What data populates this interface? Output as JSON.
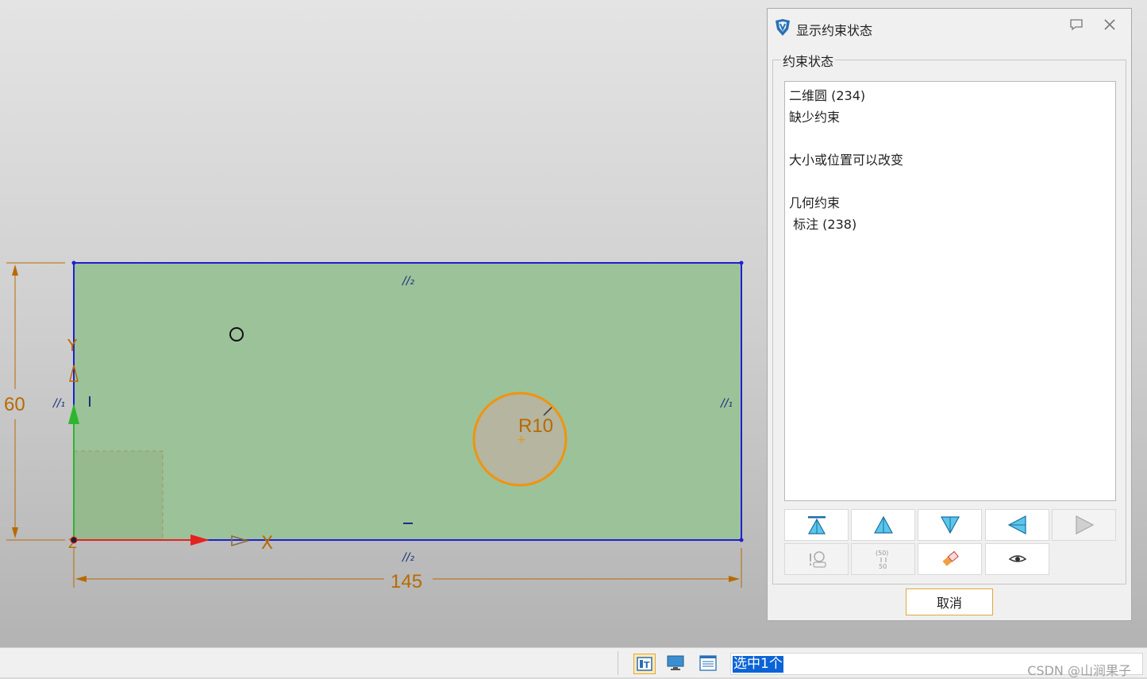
{
  "sketch": {
    "dim_height": "60",
    "dim_width": "145",
    "radius_label": "R10",
    "axis_x": "X",
    "axis_y": "Y",
    "axis_z": "Z",
    "constraint_parallel_top": "//₂",
    "constraint_parallel_bottom": "//₂",
    "constraint_parallel_left": "//₁",
    "constraint_parallel_right": "//₁",
    "colors": {
      "region_fill": "#9cc29a",
      "edge": "#1f1fd4",
      "dimension": "#b86a00",
      "circle": "#f0940e",
      "x_axis": "#e52222",
      "y_axis": "#2db52d"
    }
  },
  "dialog": {
    "title": "显示约束状态",
    "group_label": "约束状态",
    "lines": [
      "二维圆 (234)",
      "缺少约束",
      "",
      "大小或位置可以改变",
      "",
      "几何约束",
      " 标注 (238)"
    ],
    "toolbar": {
      "row1": [
        "first-icon",
        "up-icon",
        "down-icon",
        "left-icon",
        "right-icon"
      ],
      "row2": [
        "help-icon",
        "dimension-icon",
        "eraser-icon",
        "eye-icon"
      ]
    },
    "cancel_label": "取消"
  },
  "statusbar": {
    "selection_text": "选中1个",
    "watermark": "CSDN @山涧果子"
  }
}
